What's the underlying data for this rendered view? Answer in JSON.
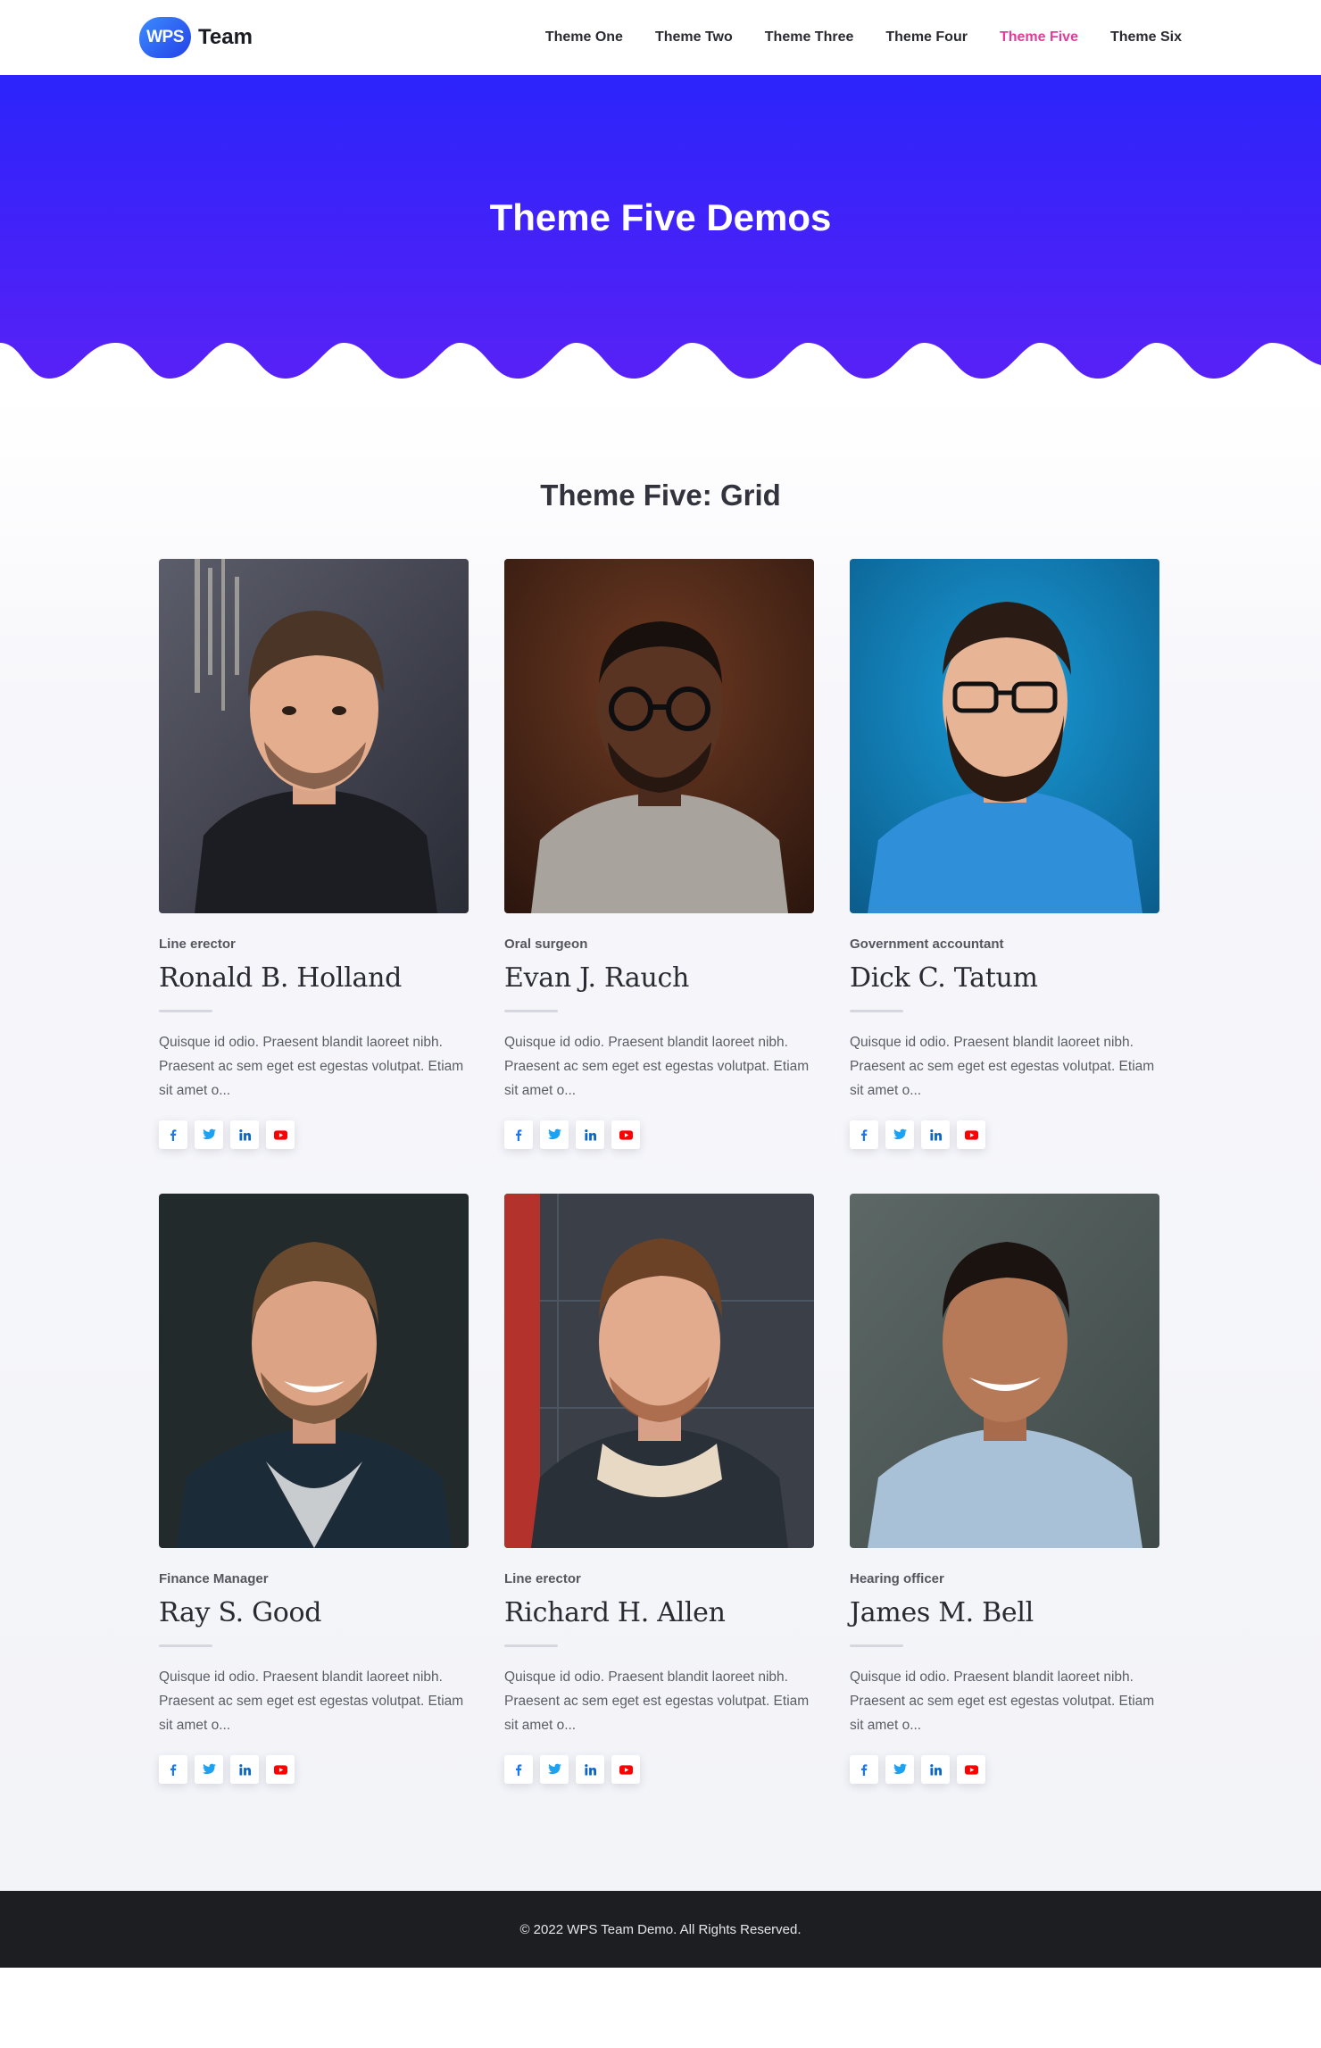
{
  "header": {
    "logo_badge": "WPS",
    "logo_text": "Team",
    "nav": [
      {
        "label": "Theme One"
      },
      {
        "label": "Theme Two"
      },
      {
        "label": "Theme Three"
      },
      {
        "label": "Theme Four"
      },
      {
        "label": "Theme Five",
        "active": true
      },
      {
        "label": "Theme Six"
      }
    ]
  },
  "hero": {
    "title": "Theme Five Demos"
  },
  "section": {
    "title": "Theme Five: Grid"
  },
  "members": [
    {
      "designation": "Line erector",
      "name": "Ronald B. Holland",
      "bio": "Quisque id odio. Praesent blandit laoreet nibh. Praesent ac sem eget est egestas volutpat. Etiam sit amet o..."
    },
    {
      "designation": "Oral surgeon",
      "name": "Evan J. Rauch",
      "bio": "Quisque id odio. Praesent blandit laoreet nibh. Praesent ac sem eget est egestas volutpat. Etiam sit amet o..."
    },
    {
      "designation": "Government accountant",
      "name": "Dick C. Tatum",
      "bio": "Quisque id odio. Praesent blandit laoreet nibh. Praesent ac sem eget est egestas volutpat. Etiam sit amet o..."
    },
    {
      "designation": "Finance Manager",
      "name": "Ray S. Good",
      "bio": "Quisque id odio. Praesent blandit laoreet nibh. Praesent ac sem eget est egestas volutpat. Etiam sit amet o..."
    },
    {
      "designation": "Line erector",
      "name": "Richard H. Allen",
      "bio": "Quisque id odio. Praesent blandit laoreet nibh. Praesent ac sem eget est egestas volutpat. Etiam sit amet o..."
    },
    {
      "designation": "Hearing officer",
      "name": "James M. Bell",
      "bio": "Quisque id odio. Praesent blandit laoreet nibh. Praesent ac sem eget est egestas volutpat. Etiam sit amet o..."
    }
  ],
  "social_icons": [
    "facebook-icon",
    "twitter-icon",
    "linkedin-icon",
    "youtube-icon"
  ],
  "colors": {
    "accent": "#e8399a",
    "hero_top": "#2b24fb",
    "hero_bottom": "#5a21f6",
    "facebook": "#1877f2",
    "twitter": "#1da1f2",
    "linkedin": "#0a66c2",
    "youtube": "#ff0000",
    "footer_bg": "#1d1e22"
  },
  "footer": {
    "text": "© 2022 WPS Team Demo. All Rights Reserved."
  }
}
